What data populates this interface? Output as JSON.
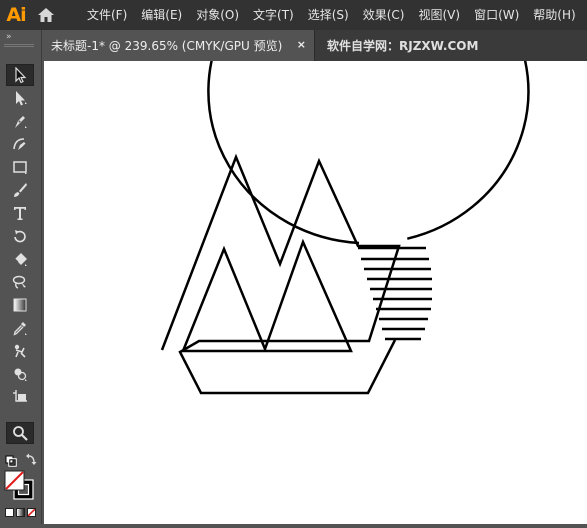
{
  "app": {
    "logo_text": "Ai"
  },
  "menu": {
    "items": [
      {
        "label": "文件(F)"
      },
      {
        "label": "编辑(E)"
      },
      {
        "label": "对象(O)"
      },
      {
        "label": "文字(T)"
      },
      {
        "label": "选择(S)"
      },
      {
        "label": "效果(C)"
      },
      {
        "label": "视图(V)"
      },
      {
        "label": "窗口(W)"
      },
      {
        "label": "帮助(H)"
      }
    ]
  },
  "tabs": {
    "active": {
      "label": "未标题-1* @ 239.65% (CMYK/GPU 预览)",
      "close": "×"
    },
    "inactive": {
      "label": "软件自学网：RJZXW.COM"
    }
  },
  "toolbar": {
    "collapse": "»",
    "tools": [
      {
        "name": "selection-tool",
        "icon": "selection-arrow-icon",
        "active": false
      },
      {
        "name": "direct-selection-tool",
        "icon": "direct-selection-icon",
        "active": false
      },
      {
        "name": "pen-tool",
        "icon": "pen-icon",
        "active": false
      },
      {
        "name": "curvature-tool",
        "icon": "curvature-icon",
        "active": false
      },
      {
        "name": "rectangle-tool",
        "icon": "rectangle-icon",
        "active": false
      },
      {
        "name": "paintbrush-tool",
        "icon": "brush-icon",
        "active": false
      },
      {
        "name": "type-tool",
        "icon": "type-icon",
        "active": false
      },
      {
        "name": "rotate-tool",
        "icon": "rotate-icon",
        "active": false
      },
      {
        "name": "eraser-tool",
        "icon": "eraser-icon",
        "active": false
      },
      {
        "name": "lasso-tool",
        "icon": "lasso-icon",
        "active": false
      },
      {
        "name": "gradient-tool",
        "icon": "gradient-icon",
        "active": false
      },
      {
        "name": "eyedropper-tool",
        "icon": "eyedropper-icon",
        "active": false
      },
      {
        "name": "puppet-warp-tool",
        "icon": "puppet-icon",
        "active": false
      },
      {
        "name": "shape-builder-tool",
        "icon": "shape-builder-icon",
        "active": false
      },
      {
        "name": "artboard-tool",
        "icon": "artboard-icon",
        "active": false
      },
      {
        "name": "zoom-tool",
        "icon": "zoom-icon",
        "active": true
      }
    ]
  },
  "colors": {
    "menubar_bg": "#323232",
    "panel_bg": "#535353",
    "logo": "#ff9a00",
    "canvas": "#ffffff",
    "stroke": "#000000"
  }
}
